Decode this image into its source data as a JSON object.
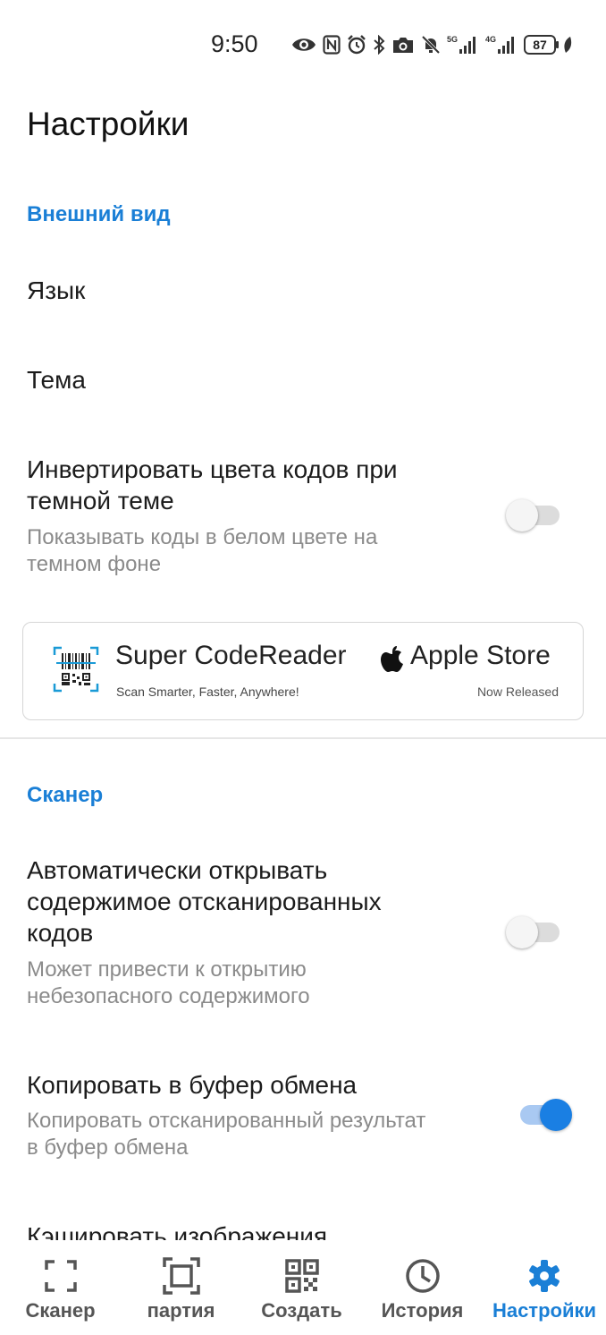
{
  "status_bar": {
    "time": "9:50",
    "battery": "87",
    "icons": [
      "eye-icon",
      "nfc-icon",
      "alarm-icon",
      "bluetooth-icon",
      "camera-icon",
      "mute-icon",
      "signal-5g-icon",
      "signal-4g-icon",
      "battery-icon",
      "leaf-icon"
    ],
    "network_labels": [
      "5G",
      "4G"
    ]
  },
  "page_title": "Настройки",
  "sections": {
    "appearance": {
      "header": "Внешний вид",
      "language_label": "Язык",
      "theme_label": "Тема",
      "invert": {
        "title_line1": "Инвертировать цвета кодов при",
        "title_line2": "темной теме",
        "subtitle_line1": "Показывать коды в белом цвете на",
        "subtitle_line2": "темном фоне",
        "enabled": false
      }
    },
    "scanner": {
      "header": "Сканер",
      "auto_open": {
        "title_line1": "Автоматически открывать",
        "title_line2": "содержимое отсканированных",
        "title_line3": "кодов",
        "subtitle_line1": "Может привести к открытию",
        "subtitle_line2": "небезопасного содержимого",
        "enabled": false
      },
      "copy_clipboard": {
        "title": "Копировать в буфер обмена",
        "subtitle_line1": "Копировать отсканированный результат",
        "subtitle_line2": "в буфер обмена",
        "enabled": true
      },
      "cache_images": {
        "title": "Кэшировать изображения"
      }
    }
  },
  "ad_banner": {
    "app_name": "Super CodeReader",
    "tagline": "Scan Smarter, Faster, Anywhere!",
    "store": "Apple Store",
    "status": "Now Released"
  },
  "bottom_nav": {
    "items": [
      {
        "label": "Сканер",
        "icon": "scan-frame-icon"
      },
      {
        "label": "партия",
        "icon": "batch-scan-icon"
      },
      {
        "label": "Создать",
        "icon": "qr-code-icon"
      },
      {
        "label": "История",
        "icon": "clock-icon"
      },
      {
        "label": "Настройки",
        "icon": "gear-icon"
      }
    ],
    "active": "Настройки"
  },
  "colors": {
    "accent": "#1a7fd6",
    "switch_on": "#1a7fe3",
    "switch_on_track": "#a9c9f2",
    "subtitle_gray": "#8b8b8b"
  }
}
